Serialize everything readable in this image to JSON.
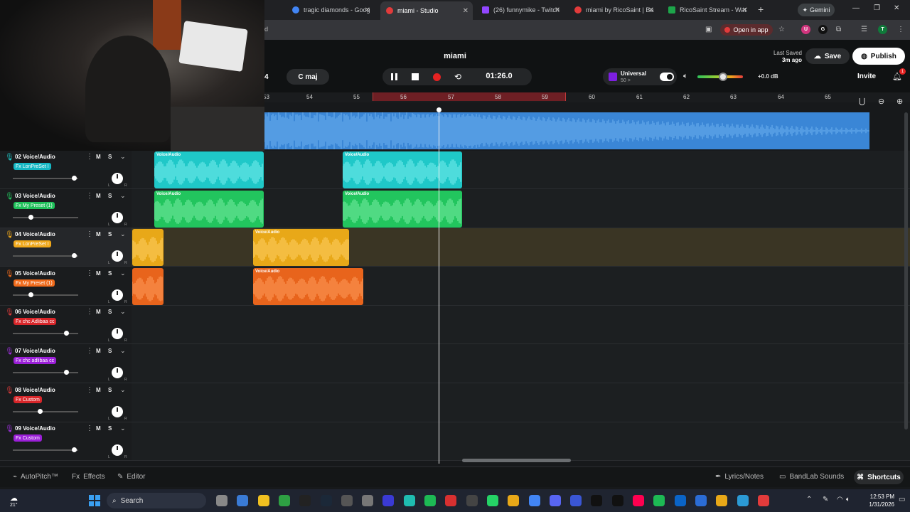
{
  "browser": {
    "tabs": [
      {
        "label": "tragic diamonds - Goog",
        "color": "#4285f4"
      },
      {
        "label": "miami - Studio",
        "color": "#e23b3b",
        "active": true
      },
      {
        "label": "(26) funnymike - Twitch",
        "color": "#9146ff"
      },
      {
        "label": "miami by RicoSaint | Ba",
        "color": "#e23b3b"
      },
      {
        "label": "RicoSaint Stream - Wat",
        "color": "#1da54a"
      }
    ],
    "gemini_label": "Gemini",
    "open_in_app": "Open in app",
    "addr_tail": "d"
  },
  "header": {
    "project_title": "miami",
    "last_saved_label": "Last Saved",
    "last_saved_value": "3m ago",
    "save_label": "Save",
    "publish_label": "Publish",
    "tempo_fragment": "4",
    "key": "C maj",
    "timecode": "01:26.0",
    "universal_label": "Universal",
    "universal_sub": "50 >",
    "volume_db": "+0.0 dB",
    "volume_level": 0.56,
    "invite_label": "Invite",
    "notification_count": "1"
  },
  "ruler": {
    "bars": [
      "53",
      "54",
      "55",
      "56",
      "57",
      "58",
      "59",
      "60",
      "61",
      "62",
      "63",
      "64",
      "65"
    ]
  },
  "clip_label": "Voice/Audio",
  "tracks": [
    {
      "name": "02 Voice/Audio",
      "fx": "Fx LonPreSet I",
      "fx_color": "#15b8c4",
      "mic_color": "#1fc8c8",
      "fader": 0.93,
      "lane_color": "#1c1f21"
    },
    {
      "name": "03 Voice/Audio",
      "fx": "Fx My Preset (1)",
      "fx_color": "#1fc05a",
      "mic_color": "#22c55e",
      "fader": 0.27,
      "lane_color": "#1c1f21"
    },
    {
      "name": "04 Voice/Audio",
      "fx": "Fx LonPreSet I",
      "fx_color": "#f0a81a",
      "mic_color": "#f0a81a",
      "fader": 0.93,
      "lane_color": "#3a3524"
    },
    {
      "name": "05 Voice/Audio",
      "fx": "Fx My Preset (1)",
      "fx_color": "#f06a1a",
      "mic_color": "#f06a1a",
      "fader": 0.27,
      "lane_color": "#1c1f21"
    },
    {
      "name": "06 Voice/Audio",
      "fx": "Fx chc Adlibaa cc",
      "fx_color": "#d8262a",
      "mic_color": "#e23b3b",
      "fader": 0.82,
      "lane_color": "#1c1f21"
    },
    {
      "name": "07 Voice/Audio",
      "fx": "Fx chc adlibaa cc",
      "fx_color": "#9b1fd8",
      "mic_color": "#a030e0",
      "fader": 0.82,
      "lane_color": "#1c1f21"
    },
    {
      "name": "08 Voice/Audio",
      "fx": "Fx Custom",
      "fx_color": "#d8262a",
      "mic_color": "#e23b3b",
      "fader": 0.41,
      "lane_color": "#1c1f21"
    },
    {
      "name": "09 Voice/Audio",
      "fx": "Fx Custom",
      "fx_color": "#9b1fd8",
      "mic_color": "#a030e0",
      "fader": 0.93,
      "lane_color": "#1c1f21"
    }
  ],
  "bottom": {
    "autopitch": "AutoPitch™",
    "effects": "Effects",
    "editor": "Editor",
    "lyrics": "Lyrics/Notes",
    "sounds": "BandLab Sounds",
    "shortcuts": "Shortcuts"
  },
  "taskbar": {
    "search_label": "Search",
    "weather": "21°",
    "time": "12:53 PM",
    "date": "1/31/2026"
  }
}
